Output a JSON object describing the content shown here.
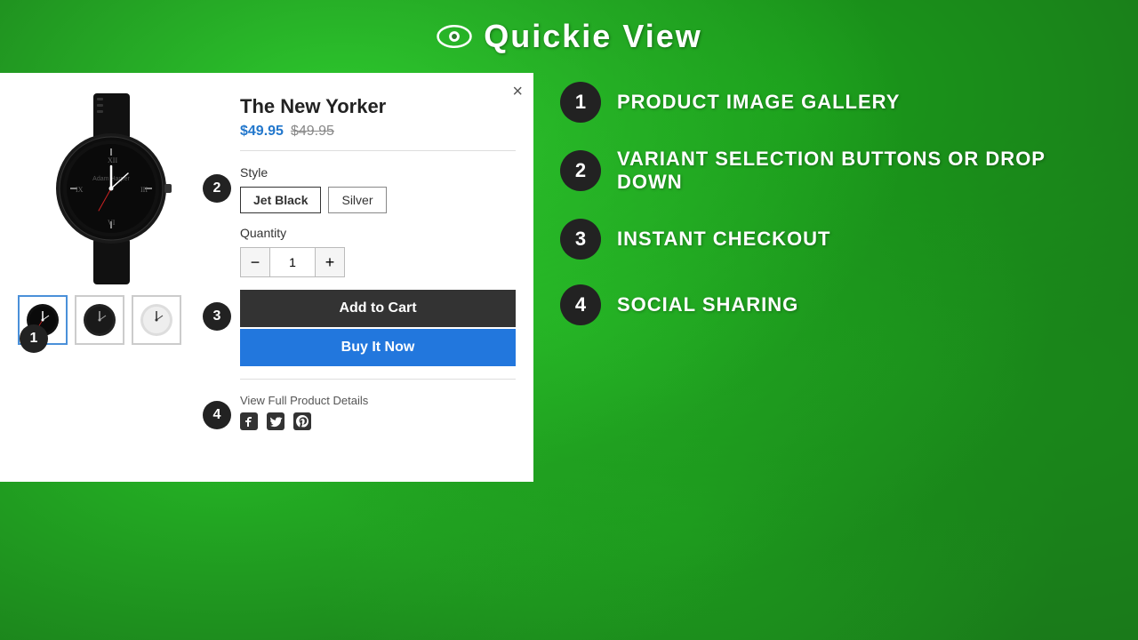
{
  "header": {
    "title": "Quickie View",
    "icon_label": "eye-icon"
  },
  "modal": {
    "close_label": "×",
    "product": {
      "title": "The New Yorker",
      "price_sale": "$49.95",
      "price_original": "$49.95",
      "style_label": "Style",
      "styles": [
        {
          "label": "Jet Black",
          "active": true
        },
        {
          "label": "Silver",
          "active": false
        }
      ],
      "quantity_label": "Quantity",
      "quantity_value": "1",
      "add_to_cart_label": "Add to Cart",
      "buy_now_label": "Buy It Now",
      "view_full_label": "View Full Product Details",
      "social": {
        "facebook": "f",
        "twitter": "t",
        "pinterest": "p"
      }
    }
  },
  "features": [
    {
      "number": "1",
      "text": "PRODUCT IMAGE GALLERY"
    },
    {
      "number": "2",
      "text": "VARIANT SELECTION BUTTONS OR DROP DOWN"
    },
    {
      "number": "3",
      "text": "INSTANT CHECKOUT"
    },
    {
      "number": "4",
      "text": "SOCIAL SHARING"
    }
  ],
  "badges": {
    "image_badge": "1",
    "variant_badge": "2",
    "checkout_badge": "3",
    "social_badge": "4"
  }
}
